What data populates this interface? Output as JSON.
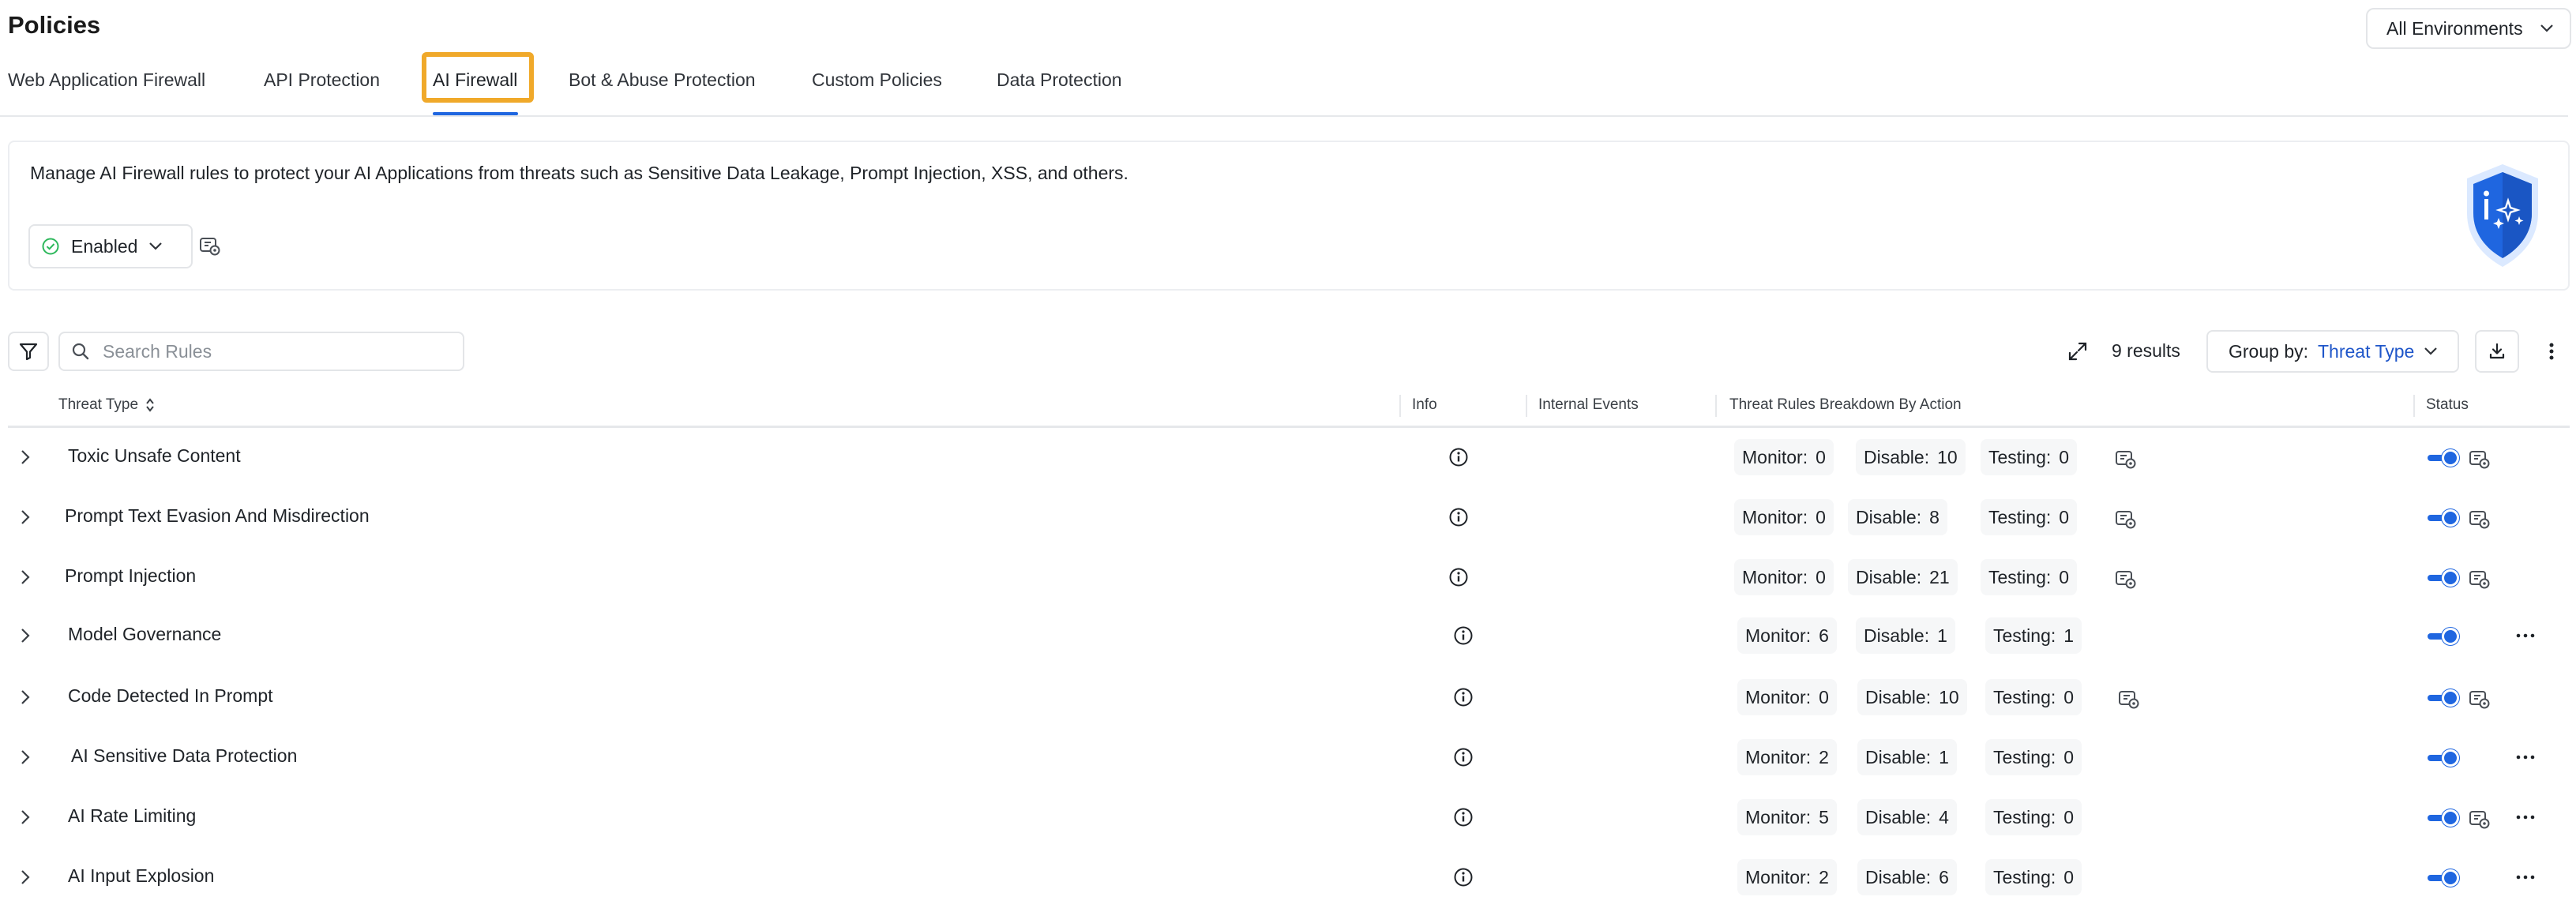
{
  "header": {
    "title": "Policies",
    "environment": "All Environments"
  },
  "tabs": [
    {
      "label": "Web Application Firewall",
      "active": false
    },
    {
      "label": "API Protection",
      "active": false
    },
    {
      "label": "AI Firewall",
      "active": true
    },
    {
      "label": "Bot & Abuse Protection",
      "active": false
    },
    {
      "label": "Custom Policies",
      "active": false
    },
    {
      "label": "Data Protection",
      "active": false
    }
  ],
  "card": {
    "description": "Manage AI Firewall rules to protect your AI Applications from threats such as Sensitive Data Leakage, Prompt Injection, XSS, and others.",
    "status": "Enabled"
  },
  "toolbar": {
    "search_placeholder": "Search Rules",
    "results": "9 results",
    "group_by_label": "Group by:",
    "group_by_value": "Threat Type"
  },
  "table": {
    "columns": {
      "threat_type": "Threat Type",
      "info": "Info",
      "internal_events": "Internal Events",
      "breakdown": "Threat Rules Breakdown By Action",
      "status": "Status"
    },
    "labels": {
      "monitor": "Monitor:",
      "disable": "Disable:",
      "testing": "Testing:"
    },
    "rows": [
      {
        "name": "Toxic Unsafe Content",
        "monitor": "0",
        "disable": "10",
        "testing": "0",
        "status_on": true
      },
      {
        "name": "Prompt Text Evasion And Misdirection",
        "monitor": "0",
        "disable": "8",
        "testing": "0",
        "status_on": true
      },
      {
        "name": "Prompt Injection",
        "monitor": "0",
        "disable": "21",
        "testing": "0",
        "status_on": true
      },
      {
        "name": "Model Governance",
        "monitor": "6",
        "disable": "1",
        "testing": "1",
        "status_on": true
      },
      {
        "name": "Code Detected In Prompt",
        "monitor": "0",
        "disable": "10",
        "testing": "0",
        "status_on": true
      },
      {
        "name": "AI Sensitive Data Protection",
        "monitor": "2",
        "disable": "1",
        "testing": "0",
        "status_on": true
      },
      {
        "name": "AI Rate Limiting",
        "monitor": "5",
        "disable": "4",
        "testing": "0",
        "status_on": true
      },
      {
        "name": "AI Input Explosion",
        "monitor": "2",
        "disable": "6",
        "testing": "0",
        "status_on": true
      }
    ]
  },
  "colors": {
    "accent": "#1f66e0",
    "highlight": "#f0a92a",
    "enabled": "#2eb85c"
  }
}
